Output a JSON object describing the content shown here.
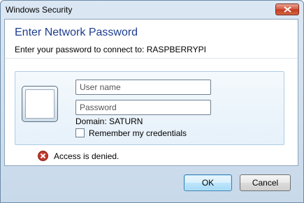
{
  "window": {
    "title": "Windows Security"
  },
  "dialog": {
    "heading": "Enter Network Password",
    "subheading": "Enter your password to connect to: RASPBERRYPI"
  },
  "credentials": {
    "username": {
      "value": "",
      "placeholder": "User name"
    },
    "password": {
      "value": "",
      "placeholder": "Password"
    },
    "domain_label": "Domain: SATURN",
    "remember": {
      "label": "Remember my credentials",
      "checked": false
    }
  },
  "error": {
    "message": "Access is denied.",
    "icon": "error-x-icon"
  },
  "buttons": {
    "ok": "OK",
    "cancel": "Cancel"
  },
  "icons": {
    "close": "close-icon",
    "avatar": "user-tile-icon"
  },
  "colors": {
    "heading": "#1e3d8f",
    "close_button": "#c8452c",
    "error_icon": "#c0392b"
  }
}
